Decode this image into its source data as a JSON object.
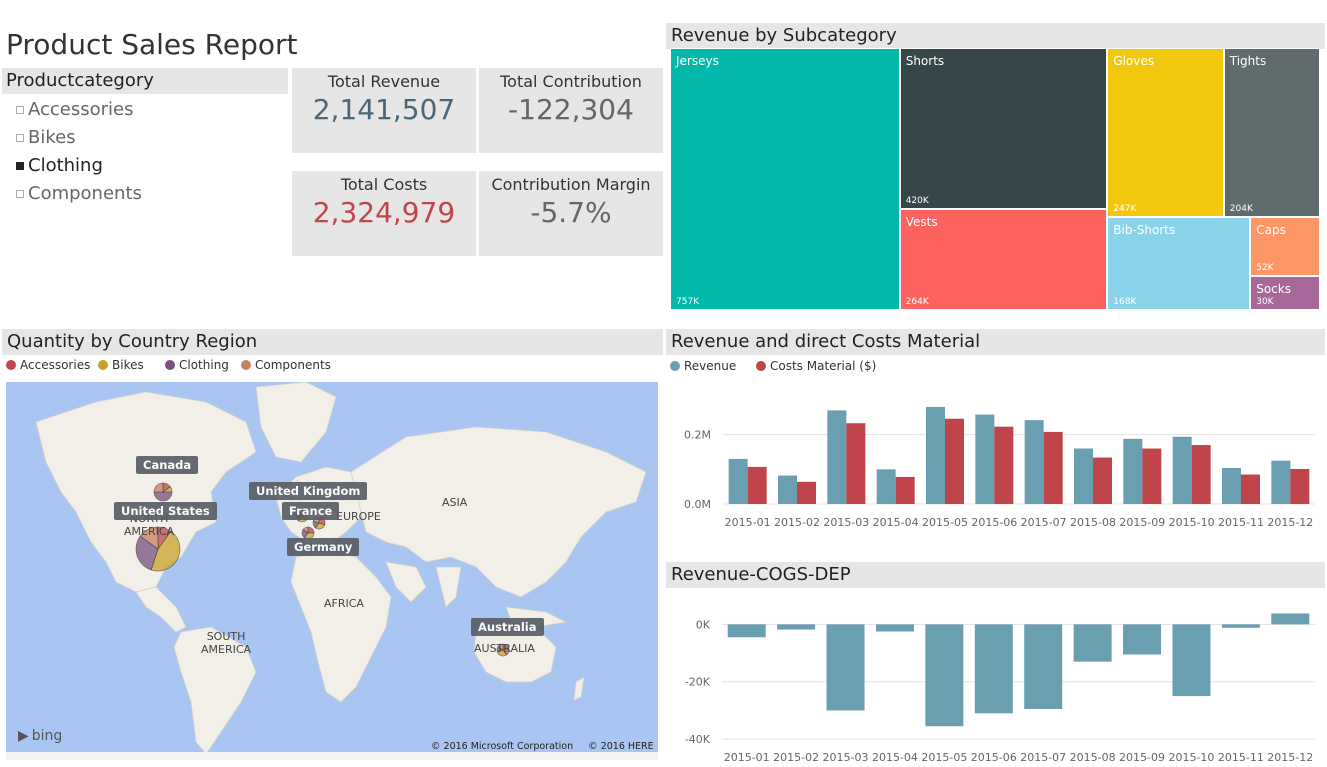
{
  "report": {
    "title": "Product Sales Report"
  },
  "slicer": {
    "header": "Productcategory",
    "items": [
      {
        "label": "Accessories",
        "selected": false
      },
      {
        "label": "Bikes",
        "selected": false
      },
      {
        "label": "Clothing",
        "selected": true
      },
      {
        "label": "Components",
        "selected": false
      }
    ]
  },
  "cards": {
    "total_revenue": {
      "label": "Total Revenue",
      "value": "2,141,507",
      "color": "#4b6777"
    },
    "total_contribution": {
      "label": "Total Contribution",
      "value": "-122,304",
      "color": "#666666"
    },
    "total_costs": {
      "label": "Total Costs",
      "value": "2,324,979",
      "color": "#c0454a"
    },
    "contribution_margin": {
      "label": "Contribution Margin",
      "value": "-5.7%",
      "color": "#666666"
    }
  },
  "treemap": {
    "title": "Revenue by Subcategory",
    "items": [
      {
        "name": "Jerseys",
        "label": "757K",
        "value": 757,
        "color": "#01b8aa"
      },
      {
        "name": "Shorts",
        "label": "420K",
        "value": 420,
        "color": "#374649"
      },
      {
        "name": "Vests",
        "label": "264K",
        "value": 264,
        "color": "#fd625e"
      },
      {
        "name": "Gloves",
        "label": "247K",
        "value": 247,
        "color": "#f2c80f"
      },
      {
        "name": "Tights",
        "label": "204K",
        "value": 204,
        "color": "#5f6b6d"
      },
      {
        "name": "Bib-Shorts",
        "label": "168K",
        "value": 168,
        "color": "#8ad4eb"
      },
      {
        "name": "Caps",
        "label": "52K",
        "value": 52,
        "color": "#fe9666"
      },
      {
        "name": "Socks",
        "label": "30K",
        "value": 30,
        "color": "#a66999"
      }
    ]
  },
  "map": {
    "title": "Quantity by Country Region",
    "legend": [
      {
        "label": "Accessories",
        "color": "#c0454a"
      },
      {
        "label": "Bikes",
        "color": "#c9a12a"
      },
      {
        "label": "Clothing",
        "color": "#7a4f7e"
      },
      {
        "label": "Components",
        "color": "#c8805c"
      }
    ],
    "country_labels": [
      "Canada",
      "United States",
      "United Kingdom",
      "France",
      "Germany",
      "Australia"
    ],
    "geo_labels": [
      "NORTH\nAMERICA",
      "EUROPE",
      "ASIA",
      "AFRICA",
      "SOUTH\nAMERICA",
      "AUSTRALIA"
    ],
    "brand": "bing",
    "copyright": "© 2016 Microsoft Corporation     © 2016 HERE",
    "colors": {
      "ocean": "#a9c6f2",
      "land": "#f1efe8"
    }
  },
  "revenue_chart": {
    "title": "Revenue and direct Costs Material",
    "legend": [
      {
        "label": "Revenue",
        "color": "#6a9fb1"
      },
      {
        "label": "Costs Material ($)",
        "color": "#c0454a"
      }
    ]
  },
  "cogs_chart": {
    "title": "Revenue-COGS-DEP"
  },
  "chart_data": [
    {
      "type": "bar",
      "title": "Revenue and direct Costs Material",
      "categories": [
        "2015-01",
        "2015-02",
        "2015-03",
        "2015-04",
        "2015-05",
        "2015-06",
        "2015-07",
        "2015-08",
        "2015-09",
        "2015-10",
        "2015-11",
        "2015-12"
      ],
      "series": [
        {
          "name": "Revenue",
          "color": "#6a9fb1",
          "values": [
            130000,
            82000,
            270000,
            100000,
            280000,
            258000,
            242000,
            160000,
            188000,
            194000,
            104000,
            125000
          ]
        },
        {
          "name": "Costs Material ($)",
          "color": "#c0454a",
          "values": [
            107000,
            64000,
            233000,
            78000,
            246000,
            223000,
            208000,
            134000,
            160000,
            170000,
            85000,
            101000
          ]
        }
      ],
      "ylim": [
        0,
        300000
      ],
      "yticks": [
        {
          "value": 0,
          "label": "0.0M"
        },
        {
          "value": 200000,
          "label": "0.2M"
        }
      ],
      "grid": true
    },
    {
      "type": "bar",
      "title": "Revenue-COGS-DEP",
      "categories": [
        "2015-01",
        "2015-02",
        "2015-03",
        "2015-04",
        "2015-05",
        "2015-06",
        "2015-07",
        "2015-08",
        "2015-09",
        "2015-10",
        "2015-11",
        "2015-12"
      ],
      "series": [
        {
          "color": "#6a9fb1",
          "values": [
            -4500,
            -1800,
            -30000,
            -2500,
            -35500,
            -31000,
            -29500,
            -13000,
            -10500,
            -25000,
            -1200,
            3800
          ]
        }
      ],
      "ylim": [
        -41000,
        5000
      ],
      "yticks": [
        {
          "value": 0,
          "label": "0K"
        },
        {
          "value": -20000,
          "label": "-20K"
        },
        {
          "value": -40000,
          "label": "-40K"
        }
      ],
      "grid": true
    }
  ]
}
